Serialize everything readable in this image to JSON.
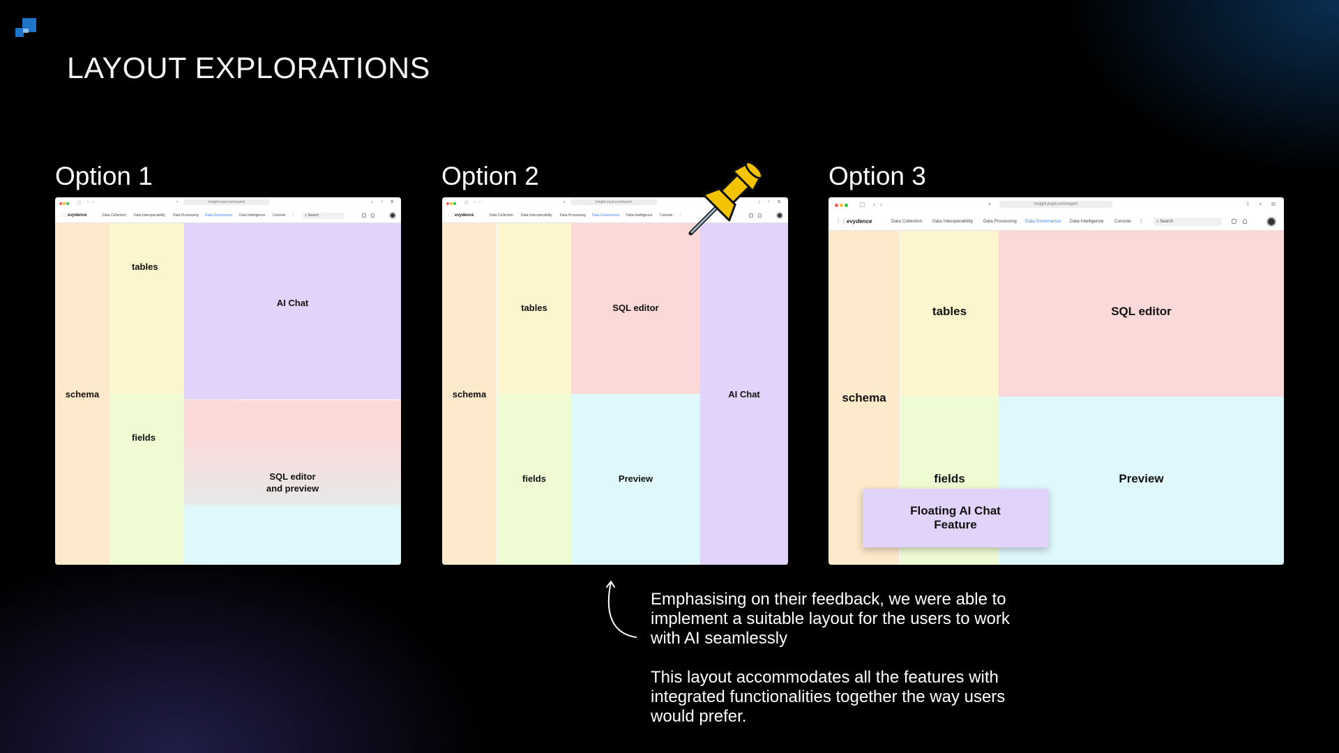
{
  "page": {
    "title": "LAYOUT EXPLORATIONS"
  },
  "browser": {
    "url": "insight.evyd.com/report",
    "brand": "evydence",
    "nav": [
      "Data Collection",
      "Data Interoperability",
      "Data Processing",
      "Data Governance",
      "Data Intelligence",
      "Console"
    ],
    "active_nav": "Data Governance",
    "search_placeholder": "Search"
  },
  "options": [
    {
      "title": "Option 1",
      "panels": {
        "schema": "schema",
        "tables": "tables",
        "fields": "fields",
        "ai_chat": "AI Chat",
        "sql_preview_line1": "SQL editor",
        "sql_preview_line2": "and preview"
      }
    },
    {
      "title": "Option 2",
      "panels": {
        "schema": "schema",
        "tables": "tables",
        "fields": "fields",
        "sql_editor": "SQL editor",
        "preview": "Preview",
        "ai_chat": "AI Chat"
      }
    },
    {
      "title": "Option 3",
      "panels": {
        "schema": "schema",
        "tables": "tables",
        "fields": "fields",
        "sql_editor": "SQL editor",
        "preview": "Preview",
        "floating_line1": "Floating AI Chat",
        "floating_line2": "Feature"
      }
    }
  ],
  "note": {
    "paragraph1": "Emphasising on their feedback, we were able to implement a suitable layout for the users to work with AI seamlessly",
    "paragraph2": "This layout accommodates all the features with integrated functionalities together the way users would prefer."
  },
  "colors": {
    "schema": "#fde9cb",
    "tables": "#fdf5cd",
    "fields": "#eefbd3",
    "ai_chat": "#e2d3fb",
    "sql_editor": "#fcd9d9",
    "preview": "#dff8fb",
    "accent": "#1e74c6",
    "pin": "#f5c400"
  },
  "icons": [
    "logo-icon",
    "pushpin-icon",
    "curved-arrow-icon",
    "search-icon",
    "apps-grid-icon",
    "avatar"
  ]
}
